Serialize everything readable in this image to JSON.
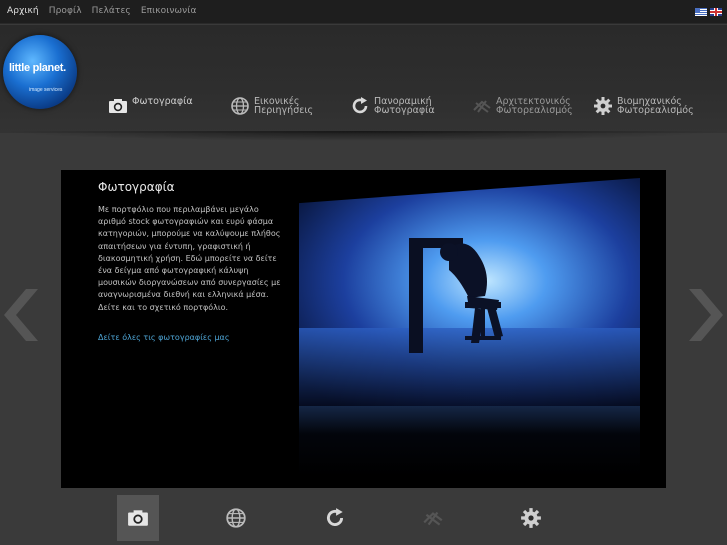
{
  "topnav": {
    "items": [
      {
        "label": "Αρχική",
        "active": true
      },
      {
        "label": "Προφίλ",
        "active": false
      },
      {
        "label": "Πελάτες",
        "active": false
      },
      {
        "label": "Επικοινωνία",
        "active": false
      }
    ],
    "flags": [
      "greek-flag-icon",
      "uk-flag-icon"
    ]
  },
  "logo": {
    "text": "little planet.",
    "subtext": "image services"
  },
  "mainnav": {
    "items": [
      {
        "label": "Φωτογραφία",
        "icon": "camera-icon",
        "active": true
      },
      {
        "label": "Εικονικές Περιηγήσεις",
        "icon": "globe-icon",
        "active": false
      },
      {
        "label": "Πανοραμική Φωτογραφία",
        "icon": "rotate-icon",
        "active": false
      },
      {
        "label": "Αρχιτεκτονικός Φωτορεαλισμός",
        "icon": "architecture-icon",
        "active": false
      },
      {
        "label": "Βιομηχανικός Φωτορεαλισμός",
        "icon": "gear-icon",
        "active": false
      }
    ]
  },
  "panel": {
    "title": "Φωτογραφία",
    "description": "Με πορτφόλιο που περιλαμβάνει μεγάλο αριθμό stock φωτογραφιών και ευρύ φάσμα κατηγοριών, μπορούμε να καλύψουμε πλήθος απαιτήσεων για έντυπη, γραφιστική ή διακοσμητική χρήση. Εδώ μπορείτε να δείτε ένα δείγμα από φωτογραφική κάλυψη μουσικών διοργανώσεων από συνεργασίες με αναγνωρισμένα διεθνή και ελληνικά μέσα. Δείτε και το σχετικό πορτφόλιο.",
    "link": "Δείτε όλες τις φωτογραφίες μας"
  },
  "bottombar": {
    "icons": [
      {
        "icon": "camera-icon",
        "active": true
      },
      {
        "icon": "globe-icon",
        "active": false
      },
      {
        "icon": "rotate-icon",
        "active": false
      },
      {
        "icon": "architecture-icon",
        "active": false
      },
      {
        "icon": "gear-icon",
        "active": false
      }
    ]
  },
  "colors": {
    "background": "#3a3a3a",
    "panel": "#000000",
    "link": "#4fa7d8",
    "topbar": "#1e1e1e"
  }
}
